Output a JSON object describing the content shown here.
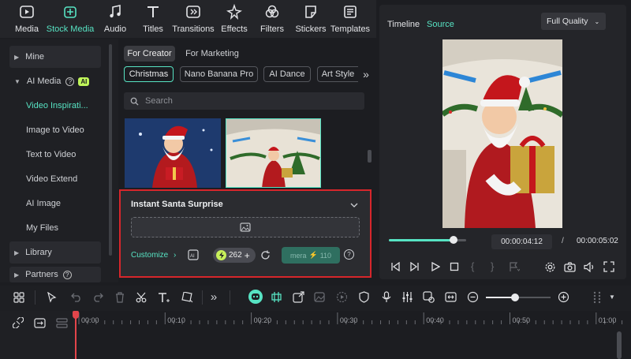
{
  "toolbar": {
    "items": [
      {
        "label": "Media",
        "icon": "media-icon"
      },
      {
        "label": "Stock Media",
        "icon": "stock-media-icon"
      },
      {
        "label": "Audio",
        "icon": "music-note-icon"
      },
      {
        "label": "Titles",
        "icon": "text-t-icon"
      },
      {
        "label": "Transitions",
        "icon": "transitions-icon"
      },
      {
        "label": "Effects",
        "icon": "effects-sparkle-icon"
      },
      {
        "label": "Filters",
        "icon": "filters-icon"
      },
      {
        "label": "Stickers",
        "icon": "stickers-icon"
      },
      {
        "label": "Templates",
        "icon": "templates-icon"
      }
    ],
    "active_index": 1,
    "accent_color": "#57e3c3"
  },
  "sidebar": {
    "mine": "Mine",
    "ai_media": "AI Media",
    "ai_badge": "AI",
    "items": [
      "Video Inspirati...",
      "Image to Video",
      "Text to Video",
      "Video Extend",
      "AI Image",
      "My Files"
    ],
    "library": "Library",
    "partners": "Partners"
  },
  "media": {
    "tabs": [
      "For Creator",
      "For Marketing"
    ],
    "tags": [
      "Christmas",
      "Nano Banana Pro",
      "AI Dance",
      "Art Style"
    ],
    "more_arrow": "»",
    "search_placeholder": "Search"
  },
  "popup": {
    "title": "Instant Santa Surprise",
    "customize": "Customize",
    "credits": "262",
    "generate_label": "mera",
    "generate_cost": "110"
  },
  "preview": {
    "tabs": [
      "Timeline",
      "Source"
    ],
    "quality": "Full Quality",
    "current_time": "00:00:04:12",
    "separator": "/",
    "total_time": "00:00:05:02",
    "progress": 0.84
  },
  "timeline": {
    "ticks": [
      "00:00",
      "00:10",
      "00:20",
      "00:30",
      "00:40",
      "00:50",
      "01:00"
    ]
  }
}
